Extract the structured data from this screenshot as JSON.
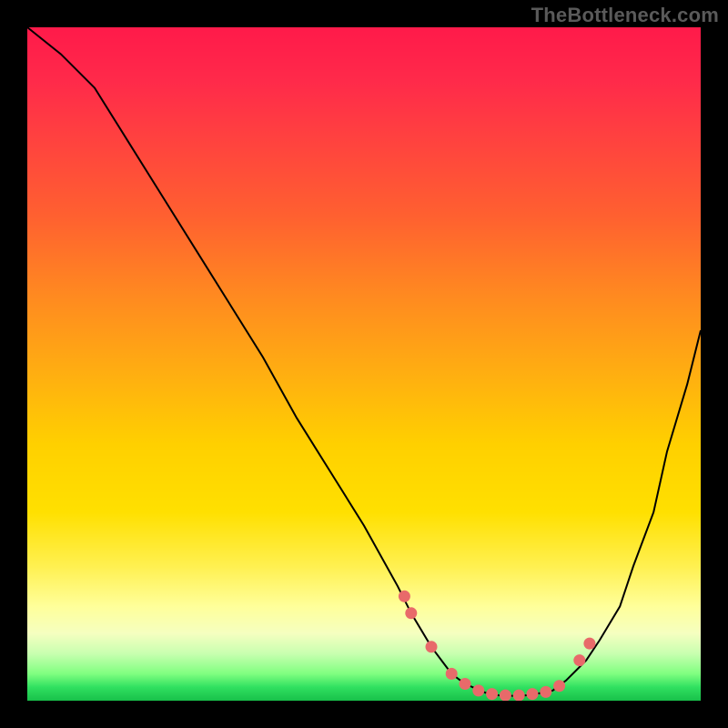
{
  "attribution": "TheBottleneck.com",
  "chart_data": {
    "type": "line",
    "title": "",
    "xlabel": "",
    "ylabel": "",
    "xlim": [
      0,
      100
    ],
    "ylim": [
      0,
      100
    ],
    "series": [
      {
        "name": "curve",
        "x": [
          0,
          5,
          10,
          15,
          20,
          25,
          30,
          35,
          40,
          45,
          50,
          55,
          57,
          60,
          63,
          65,
          68,
          70,
          73,
          75,
          78,
          80,
          83,
          85,
          88,
          90,
          93,
          95,
          98,
          100
        ],
        "y": [
          100,
          96,
          91,
          83,
          75,
          67,
          59,
          51,
          42,
          34,
          26,
          17,
          13,
          8,
          4,
          2.5,
          1.2,
          0.8,
          0.7,
          0.9,
          1.5,
          3,
          6,
          9,
          14,
          20,
          28,
          37,
          47,
          55
        ]
      }
    ],
    "markers": {
      "name": "dots",
      "x": [
        56,
        57,
        60,
        63,
        65,
        67,
        69,
        71,
        73,
        75,
        77,
        79,
        82,
        83.5
      ],
      "y": [
        15.5,
        13,
        8,
        4,
        2.5,
        1.5,
        1.0,
        0.8,
        0.8,
        1.0,
        1.3,
        2.2,
        6,
        8.5
      ]
    },
    "colors": {
      "curve": "#000000",
      "markers": "#e86a6a"
    }
  }
}
